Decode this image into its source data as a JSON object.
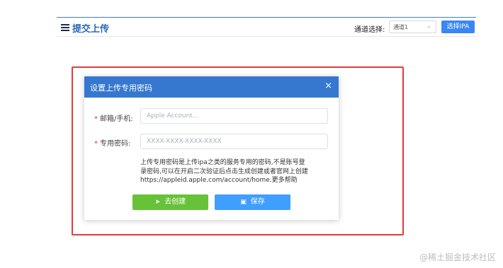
{
  "header": {
    "title": "提交上传",
    "channel_label": "通道选择:",
    "channel_value": "通道1",
    "select_ipa_label": "选择IPA"
  },
  "modal": {
    "title": "设置上传专用密码",
    "close": "×",
    "email_label": "邮箱/手机:",
    "email_placeholder": "Apple Account...",
    "password_label": "专用密码:",
    "password_placeholder": "XXXX-XXXX-XXXX-XXXX",
    "required_mark": "*",
    "help_lines": [
      "上传专用密码是上传ipa之类的服务专用的密码,不是账号登",
      "录密码,可以在开启二次验证后点击生成创建或者官网上创建",
      "https://appleid.apple.com/account/home.更多帮助"
    ],
    "create_button": "去创建",
    "save_button": "保存"
  },
  "colors": {
    "header_accent": "#2f66b3",
    "modal_header": "#3677cf",
    "create_green": "#67c23a",
    "save_blue": "#409eff",
    "highlight_red": "#e23b3b"
  },
  "watermark": "@稀土掘金技术社区"
}
